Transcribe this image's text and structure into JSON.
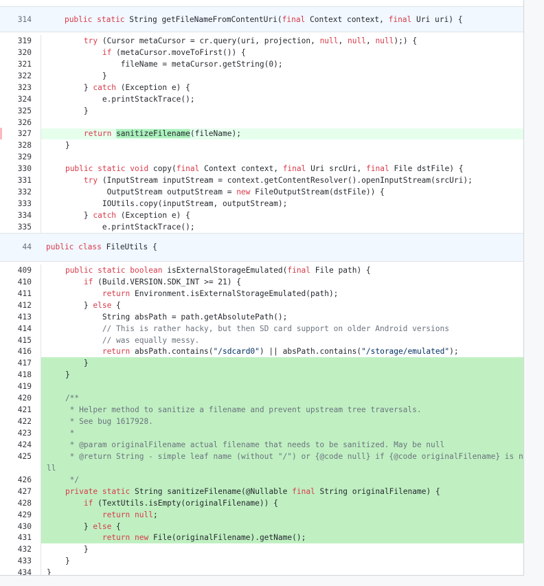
{
  "hunks": [
    {
      "header": {
        "line": "314",
        "text": "    public static String getFileNameFromContentUri(final Context context, final Uri uri) {"
      },
      "lines": [
        {
          "n": "319",
          "text": "        try (Cursor metaCursor = cr.query(uri, projection, null, null, null);) {",
          "added": false
        },
        {
          "n": "320",
          "text": "            if (metaCursor.moveToFirst()) {",
          "added": false
        },
        {
          "n": "321",
          "text": "                fileName = metaCursor.getString(0);",
          "added": false
        },
        {
          "n": "322",
          "text": "            }",
          "added": false
        },
        {
          "n": "323",
          "text": "        } catch (Exception e) {",
          "added": false
        },
        {
          "n": "324",
          "text": "            e.printStackTrace();",
          "added": false
        },
        {
          "n": "325",
          "text": "        }",
          "added": false
        },
        {
          "n": "326",
          "text": "",
          "added": false
        },
        {
          "n": "327",
          "text": "        return sanitizeFilename(fileName);",
          "added": "soft"
        },
        {
          "n": "328",
          "text": "    }",
          "added": false
        },
        {
          "n": "329",
          "text": "",
          "added": false
        },
        {
          "n": "330",
          "text": "    public static void copy(final Context context, final Uri srcUri, final File dstFile) {",
          "added": false
        },
        {
          "n": "331",
          "text": "        try (InputStream inputStream = context.getContentResolver().openInputStream(srcUri);",
          "added": false
        },
        {
          "n": "332",
          "text": "             OutputStream outputStream = new FileOutputStream(dstFile)) {",
          "added": false
        },
        {
          "n": "333",
          "text": "            IOUtils.copy(inputStream, outputStream);",
          "added": false
        },
        {
          "n": "334",
          "text": "        } catch (Exception e) {",
          "added": false
        },
        {
          "n": "335",
          "text": "            e.printStackTrace();",
          "added": false
        }
      ]
    },
    {
      "header": {
        "line": "44",
        "text": "public class FileUtils {"
      },
      "lines": [
        {
          "n": "409",
          "text": "    public static boolean isExternalStorageEmulated(final File path) {",
          "added": false
        },
        {
          "n": "410",
          "text": "        if (Build.VERSION.SDK_INT >= 21) {",
          "added": false
        },
        {
          "n": "411",
          "text": "            return Environment.isExternalStorageEmulated(path);",
          "added": false
        },
        {
          "n": "412",
          "text": "        } else {",
          "added": false
        },
        {
          "n": "413",
          "text": "            String absPath = path.getAbsolutePath();",
          "added": false
        },
        {
          "n": "414",
          "text": "            // This is rather hacky, but then SD card support on older Android versions",
          "added": false
        },
        {
          "n": "415",
          "text": "            // was equally messy.",
          "added": false
        },
        {
          "n": "416",
          "text": "            return absPath.contains(\"/sdcard0\") || absPath.contains(\"/storage/emulated\");",
          "added": false
        },
        {
          "n": "417",
          "text": "        }",
          "added": true
        },
        {
          "n": "418",
          "text": "    }",
          "added": true
        },
        {
          "n": "419",
          "text": "",
          "added": true
        },
        {
          "n": "420",
          "text": "    /**",
          "added": true
        },
        {
          "n": "421",
          "text": "     * Helper method to sanitize a filename and prevent upstream tree traversals.",
          "added": true
        },
        {
          "n": "422",
          "text": "     * See bug 1617928.",
          "added": true
        },
        {
          "n": "423",
          "text": "     *",
          "added": true
        },
        {
          "n": "424",
          "text": "     * @param originalFilename actual filename that needs to be sanitized. May be null",
          "added": true
        },
        {
          "n": "425",
          "text": "     * @return String - simple leaf name (without \"/\") or {@code null} if {@code originalFilename} is nu",
          "added": true
        },
        {
          "n": "",
          "text": "ll",
          "added": true,
          "wrap": true
        },
        {
          "n": "426",
          "text": "     */",
          "added": true
        },
        {
          "n": "427",
          "text": "    private static String sanitizeFilename(@Nullable final String originalFilename) {",
          "added": true
        },
        {
          "n": "428",
          "text": "        if (TextUtils.isEmpty(originalFilename)) {",
          "added": true
        },
        {
          "n": "429",
          "text": "            return null;",
          "added": true
        },
        {
          "n": "430",
          "text": "        } else {",
          "added": true
        },
        {
          "n": "431",
          "text": "            return new File(originalFilename).getName();",
          "added": true
        },
        {
          "n": "432",
          "text": "        }",
          "added": false
        },
        {
          "n": "433",
          "text": "    }",
          "added": false
        },
        {
          "n": "434",
          "text": "}",
          "added": false
        }
      ]
    }
  ],
  "colors": {
    "added": "#c0f0c2",
    "added_soft": "#e6ffed",
    "hunk_header": "#f1f8ff"
  }
}
